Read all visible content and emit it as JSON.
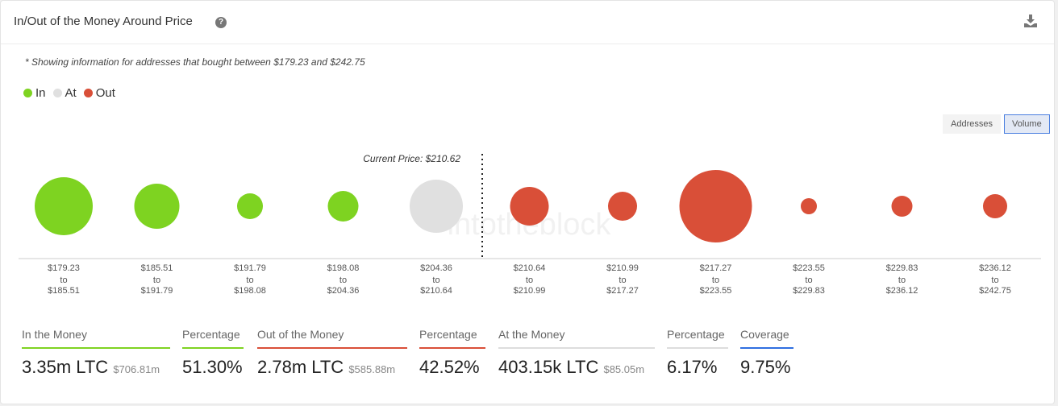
{
  "header": {
    "title": "In/Out of the Money Around Price",
    "help_icon": "?"
  },
  "note": "* Showing information for addresses that bought between $179.23 and $242.75",
  "legend": [
    {
      "label": "In",
      "color": "#7ed321"
    },
    {
      "label": "At",
      "color": "#e0e0e0"
    },
    {
      "label": "Out",
      "color": "#d94f38"
    }
  ],
  "toggle": {
    "addresses": "Addresses",
    "volume": "Volume",
    "selected": "Volume"
  },
  "watermark": "intotheblock",
  "chart_data": {
    "type": "bubble",
    "current_price_label": "Current Price: $210.62",
    "current_price": 210.62,
    "buckets": [
      {
        "from": "$179.23",
        "to": "$185.51",
        "status": "in",
        "relative_volume": 1296
      },
      {
        "from": "$185.51",
        "to": "$191.79",
        "status": "in",
        "relative_volume": 784
      },
      {
        "from": "$191.79",
        "to": "$198.08",
        "status": "in",
        "relative_volume": 256
      },
      {
        "from": "$198.08",
        "to": "$204.36",
        "status": "in",
        "relative_volume": 361
      },
      {
        "from": "$204.36",
        "to": "$210.64",
        "status": "at",
        "relative_volume": 1089
      },
      {
        "from": "$210.64",
        "to": "$210.99",
        "status": "out",
        "relative_volume": 576
      },
      {
        "from": "$210.99",
        "to": "$217.27",
        "status": "out",
        "relative_volume": 324
      },
      {
        "from": "$217.27",
        "to": "$223.55",
        "status": "out",
        "relative_volume": 2025
      },
      {
        "from": "$223.55",
        "to": "$229.83",
        "status": "out",
        "relative_volume": 100
      },
      {
        "from": "$229.83",
        "to": "$236.12",
        "status": "out",
        "relative_volume": 169
      },
      {
        "from": "$236.12",
        "to": "$242.75",
        "status": "out",
        "relative_volume": 225
      }
    ],
    "to_word": "to"
  },
  "stats": [
    {
      "label": "In the Money",
      "value": "3.35m LTC",
      "sub": "$706.81m",
      "color": "#7ed321"
    },
    {
      "label": "Percentage",
      "value": "51.30%",
      "sub": "",
      "color": "#7ed321"
    },
    {
      "label": "Out of the Money",
      "value": "2.78m LTC",
      "sub": "$585.88m",
      "color": "#d94f38"
    },
    {
      "label": "Percentage",
      "value": "42.52%",
      "sub": "",
      "color": "#d94f38"
    },
    {
      "label": "At the Money",
      "value": "403.15k LTC",
      "sub": "$85.05m",
      "color": "#dddddd"
    },
    {
      "label": "Percentage",
      "value": "6.17%",
      "sub": "",
      "color": "#dddddd"
    },
    {
      "label": "Coverage",
      "value": "9.75%",
      "sub": "",
      "color": "#2f6fe0"
    }
  ]
}
